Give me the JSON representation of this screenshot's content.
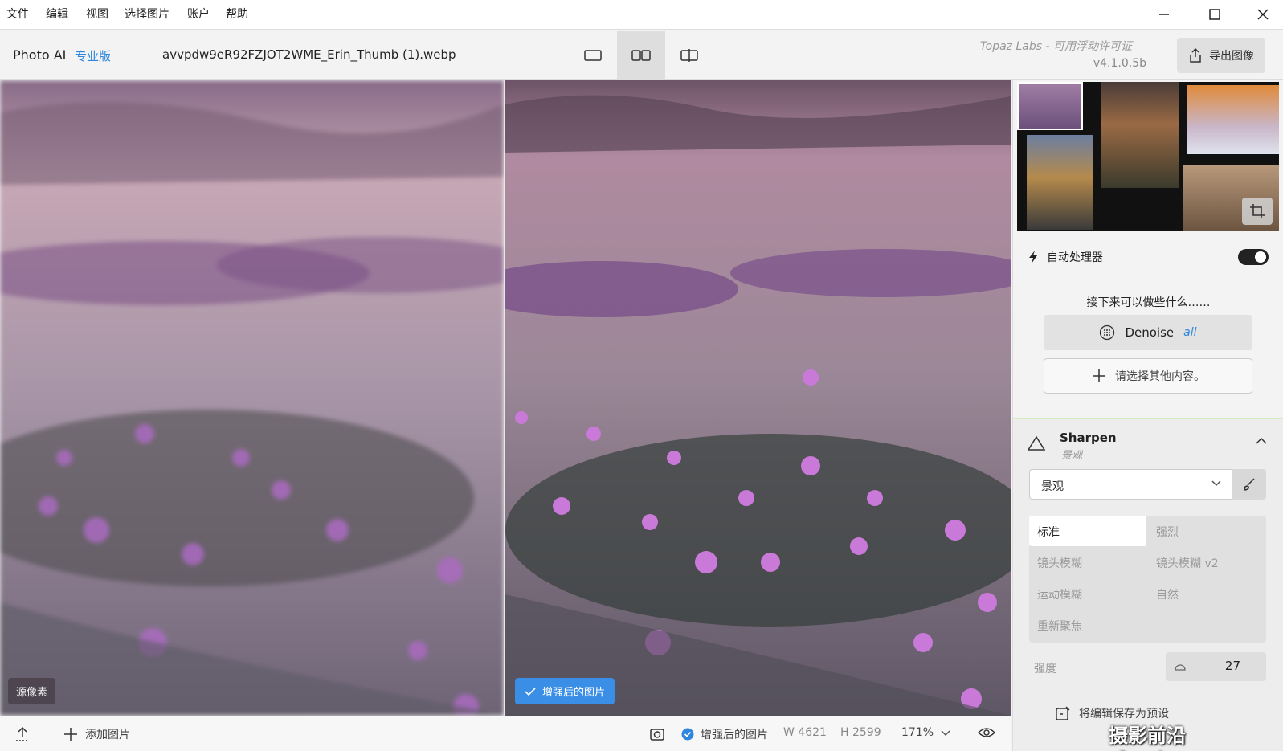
{
  "menu": [
    "文件",
    "编辑",
    "视图",
    "选择图片",
    "账户",
    "帮助"
  ],
  "toolbar": {
    "app_name": "Photo AI",
    "edition": "专业版",
    "filename": "avvpdw9eR92FZJOT2WME_Erin_Thumb (1).webp",
    "license": "Topaz Labs - 可用浮动许可证",
    "version": "v4.1.0.5b",
    "export_label": "导出图像"
  },
  "view_modes": {
    "active": "side-by-side"
  },
  "compare": {
    "source_label": "源像素",
    "enhanced_label": "增强后的图片"
  },
  "bottombar": {
    "add_image": "添加图片",
    "preview_label": "增强后的图片",
    "width": "W 4621",
    "height": "H 2599",
    "zoom": "171%"
  },
  "sidebar": {
    "auto_processor": "自动处理器",
    "auto_processor_on": true,
    "next_title": "接下来可以做些什么……",
    "denoise": {
      "label": "Denoise",
      "mode": "all"
    },
    "add_other": "请选择其他内容。",
    "sharpen": {
      "title": "Sharpen",
      "subtitle": "景观",
      "select_value": "景观",
      "models": [
        "标准",
        "强烈",
        "镜头模糊",
        "镜头模糊 v2",
        "运动模糊",
        "自然",
        "重新聚焦"
      ],
      "active_model": "标准",
      "strength_label": "强度",
      "strength_value": "27"
    },
    "apply_label": "将编辑保存为预设"
  },
  "watermark": "摄影前沿 sheyingzyz.com",
  "colors": {
    "accent": "#2e86de",
    "enhanced_badge": "#3a8ee6"
  }
}
